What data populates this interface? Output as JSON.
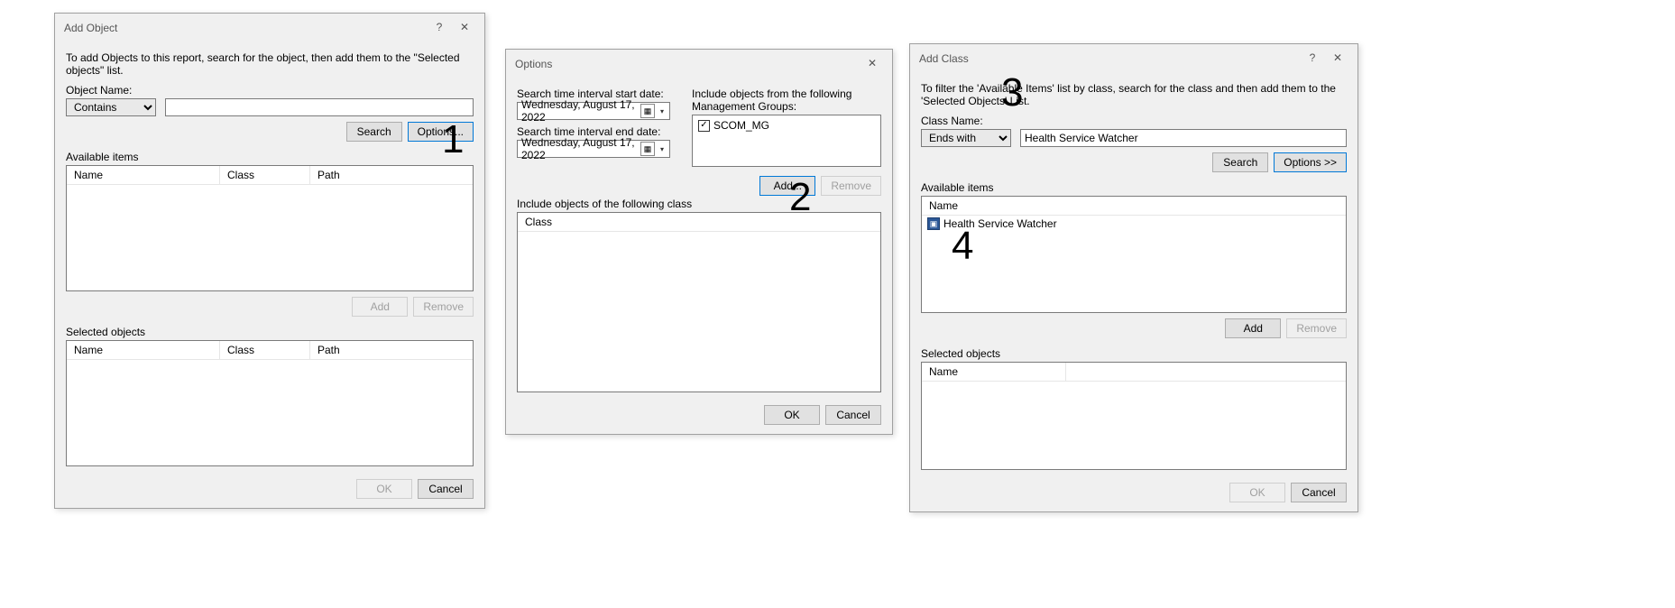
{
  "annotations": {
    "n1": "1",
    "n2": "2",
    "n3": "3",
    "n4": "4"
  },
  "dlg1": {
    "title": "Add Object",
    "help": "?",
    "close": "✕",
    "instruction": "To add Objects to this report, search for the object, then add them to the \"Selected objects\" list.",
    "objectNameLabel": "Object Name:",
    "filterMode": "Contains",
    "searchValue": "",
    "searchBtn": "Search",
    "optionsBtn": "Options...",
    "availLabel": "Available items",
    "cols": {
      "name": "Name",
      "class": "Class",
      "path": "Path"
    },
    "addBtn": "Add",
    "removeBtn": "Remove",
    "selLabel": "Selected objects",
    "okBtn": "OK",
    "cancelBtn": "Cancel"
  },
  "dlg2": {
    "title": "Options",
    "close": "✕",
    "startLabel": "Search time interval start date:",
    "endLabel": "Search time interval end date:",
    "startDate": "Wednesday,  August  17, 2022",
    "endDate": "Wednesday,  August  17, 2022",
    "mgLabel": "Include objects from the following Management Groups:",
    "mgItem": "SCOM_MG",
    "classSectionLabel": "Include objects of the following class",
    "classCol": "Class",
    "addBtn": "Add...",
    "removeBtn": "Remove",
    "okBtn": "OK",
    "cancelBtn": "Cancel"
  },
  "dlg3": {
    "title": "Add Class",
    "help": "?",
    "close": "✕",
    "instruction": "To filter the 'Available Items' list by class, search for the class and then add them to the 'Selected Objects' List.",
    "classNameLabel": "Class Name:",
    "filterMode": "Ends with",
    "searchValue": "Health Service Watcher",
    "searchBtn": "Search",
    "optionsBtn": "Options >>",
    "availLabel": "Available items",
    "colName": "Name",
    "availItem": "Health Service Watcher",
    "addBtn": "Add",
    "removeBtn": "Remove",
    "selLabel": "Selected objects",
    "okBtn": "OK",
    "cancelBtn": "Cancel"
  }
}
